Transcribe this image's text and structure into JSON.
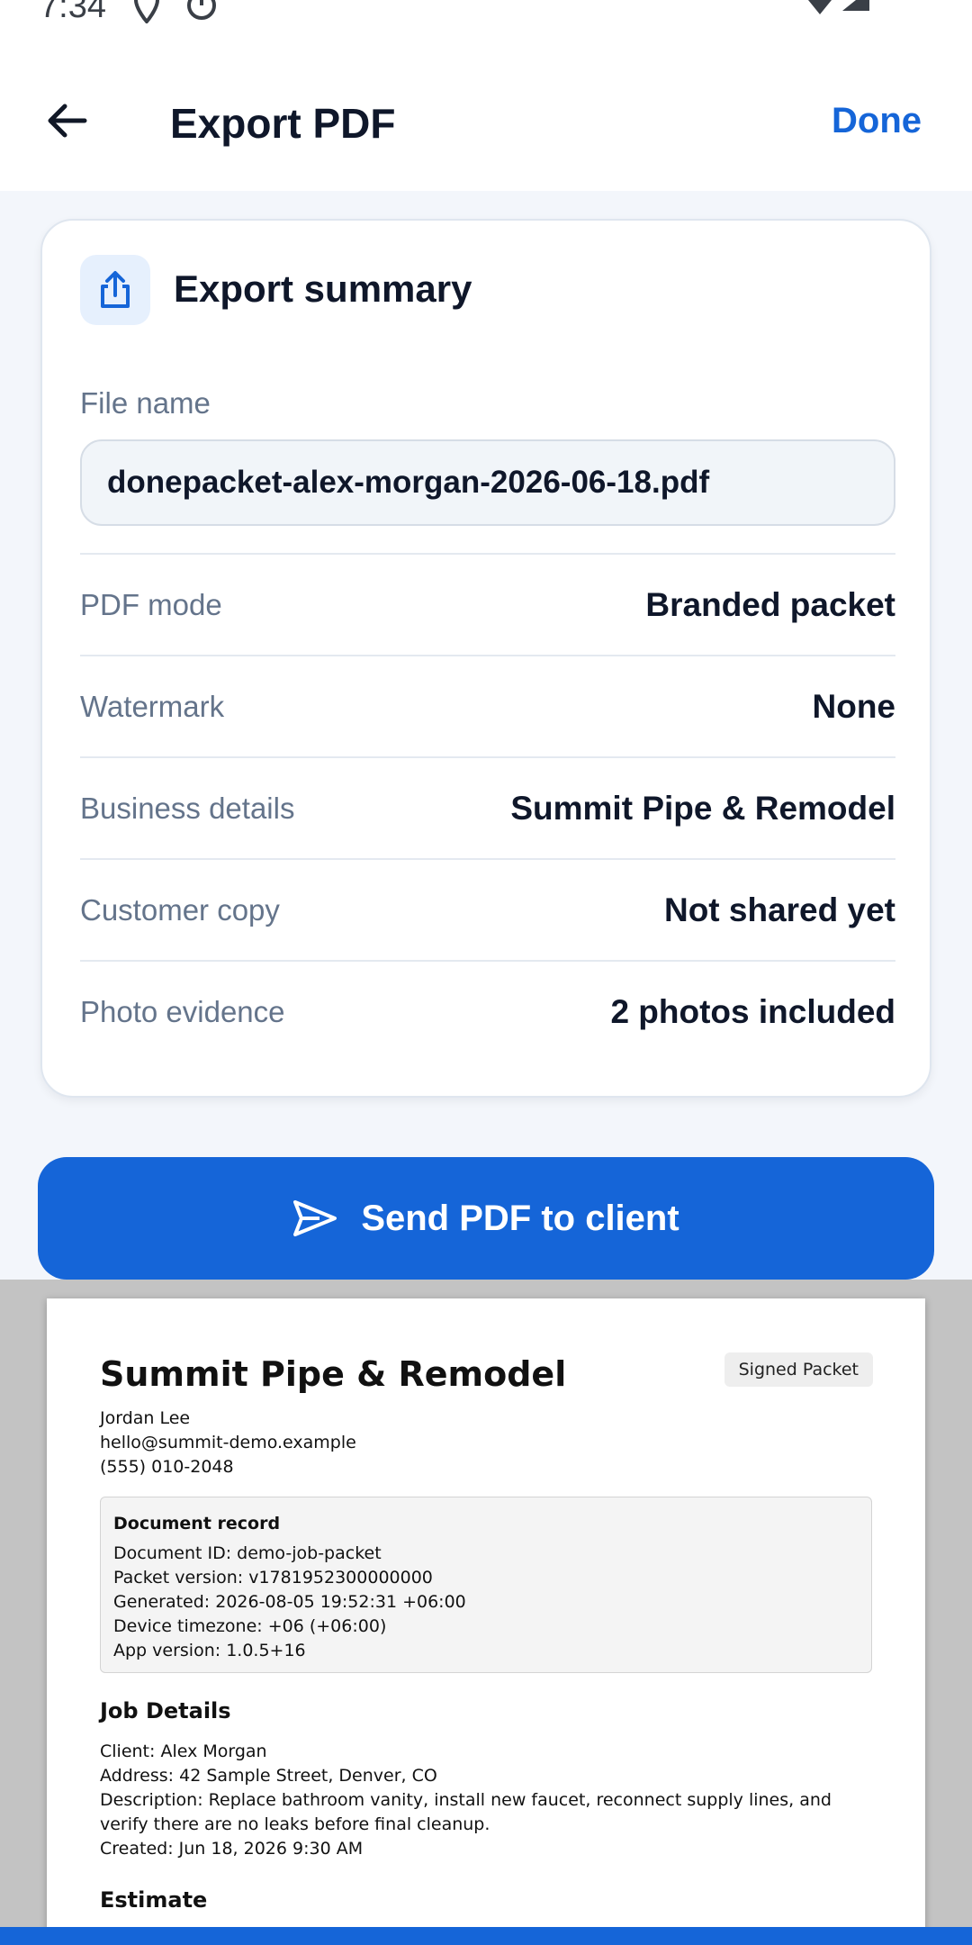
{
  "status_bar": {
    "time": "7:34"
  },
  "app_bar": {
    "title": "Export PDF",
    "done_label": "Done"
  },
  "summary": {
    "title": "Export summary",
    "file_name_label": "File name",
    "file_name_value": "donepacket-alex-morgan-2026-06-18.pdf",
    "rows": [
      {
        "label": "PDF mode",
        "value": "Branded packet"
      },
      {
        "label": "Watermark",
        "value": "None"
      },
      {
        "label": "Business details",
        "value": "Summit Pipe & Remodel"
      },
      {
        "label": "Customer copy",
        "value": "Not shared yet"
      },
      {
        "label": "Photo evidence",
        "value": "2 photos included"
      }
    ]
  },
  "send_button": {
    "label": "Send PDF to client"
  },
  "pdf": {
    "business_name": "Summit Pipe & Remodel",
    "badge": "Signed Packet",
    "contact": [
      "Jordan Lee",
      "hello@summit-demo.example",
      "(555) 010-2048"
    ],
    "record": {
      "title": "Document record",
      "lines": [
        "Document ID: demo-job-packet",
        "Packet version: v1781952300000000",
        "Generated: 2026-08-05 19:52:31 +06:00",
        "Device timezone: +06 (+06:00)",
        "App version: 1.0.5+16"
      ]
    },
    "job_details_title": "Job Details",
    "job_lines": [
      "Client: Alex Morgan",
      "Address: 42 Sample Street, Denver, CO",
      "Description: Replace bathroom vanity, install new faucet, reconnect supply lines, and verify there are no leaks before final cleanup.",
      "Created: Jun 18, 2026 9:30 AM"
    ],
    "estimate_title": "Estimate"
  },
  "colors": {
    "accent": "#1565d8",
    "text": "#0f172a",
    "muted": "#64748b"
  }
}
